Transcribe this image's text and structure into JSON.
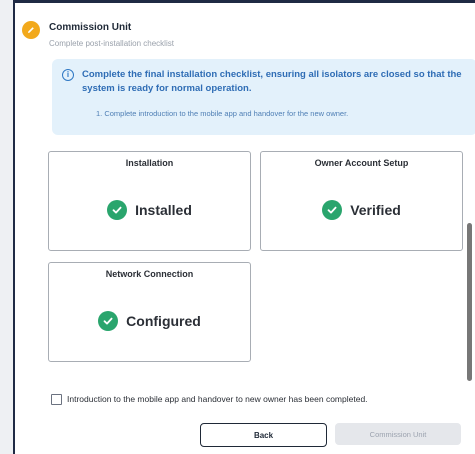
{
  "step": {
    "title": "Commission Unit",
    "subtitle": "Complete post-installation checklist",
    "badge_color": "#f2a91c"
  },
  "info": {
    "icon": "info-icon",
    "message": "Complete the final installation checklist, ensuring all isolators are closed so that the system is ready for normal operation.",
    "step_item": "1.  Complete introduction to the mobile app and handover for the new owner."
  },
  "cards": [
    {
      "title": "Installation",
      "status": "Installed",
      "icon": "check-circle-icon"
    },
    {
      "title": "Owner Account Setup",
      "status": "Verified",
      "icon": "check-circle-icon"
    },
    {
      "title": "Network Connection",
      "status": "Configured",
      "icon": "check-circle-icon"
    }
  ],
  "handover_checkbox": {
    "label": "Introduction to the mobile app and handover to new owner has been completed.",
    "checked": false
  },
  "buttons": {
    "back": "Back",
    "commission": "Commission Unit"
  },
  "colors": {
    "success": "#2aa56d",
    "info_bg": "#e3f1fb",
    "info_text": "#2f6db5",
    "accent": "#f2a91c"
  }
}
